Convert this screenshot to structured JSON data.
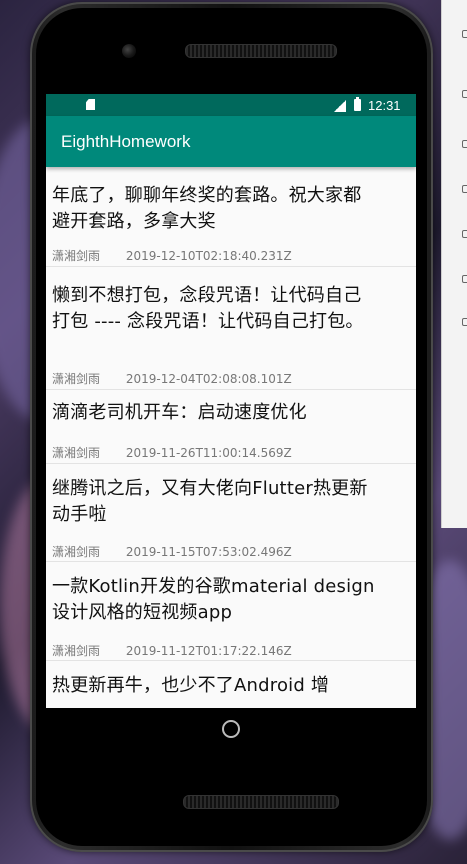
{
  "status_bar": {
    "time": "12:31",
    "icons": [
      "sd-card-icon",
      "signal-icon",
      "battery-icon"
    ]
  },
  "app_bar": {
    "title": "EighthHomework"
  },
  "articles": [
    {
      "title": "年底了，聊聊年终奖的套路。祝大家都避开套路，多拿大奖",
      "author": "潇湘剑雨",
      "date": "2019-12-10T02:18:40.231Z"
    },
    {
      "title": "懒到不想打包，念段咒语！让代码自己打包 ---- 念段咒语！让代码自己打包。",
      "author": "潇湘剑雨",
      "date": "2019-12-04T02:08:08.101Z"
    },
    {
      "title": "滴滴老司机开车：启动速度优化",
      "author": "潇湘剑雨",
      "date": "2019-11-26T11:00:14.569Z"
    },
    {
      "title": "继腾讯之后，又有大佬向Flutter热更新动手啦",
      "author": "潇湘剑雨",
      "date": "2019-11-15T07:53:02.496Z"
    },
    {
      "title": "一款Kotlin开发的谷歌material design 设计风格的短视频app",
      "author": "潇湘剑雨",
      "date": "2019-11-12T01:17:22.146Z"
    },
    {
      "title": "热更新再牛，也少不了Android 增",
      "author": "",
      "date": ""
    }
  ],
  "colors": {
    "status_bar": "#00695c",
    "app_bar": "#00897b",
    "background": "#fafafa"
  }
}
